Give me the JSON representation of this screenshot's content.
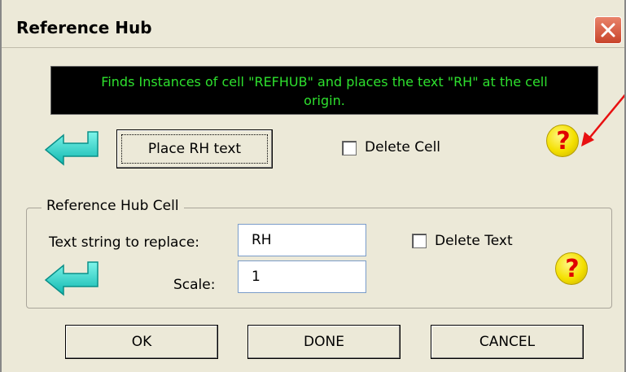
{
  "window": {
    "title": "Reference Hub",
    "close_icon": "close-icon"
  },
  "info": {
    "line1": "Finds  Instances of cell \"REFHUB\" and places the text \"RH\" at the cell",
    "line2": "origin."
  },
  "top_section": {
    "arrow_icon": "return-arrow-icon",
    "place_button_label": "Place RH text",
    "delete_cell_label": "Delete Cell",
    "delete_cell_checked": false,
    "help_icon": "help-icon"
  },
  "group": {
    "title": "Reference Hub Cell",
    "text_string_label": "Text string to replace:",
    "text_string_value": "RH",
    "delete_text_label": "Delete Text",
    "delete_text_checked": false,
    "scale_label": "Scale:",
    "scale_value": "1",
    "arrow_icon": "return-arrow-icon",
    "help_icon": "help-icon"
  },
  "footer": {
    "ok_label": "OK",
    "done_label": "DONE",
    "cancel_label": "CANCEL"
  },
  "colors": {
    "dialog_bg": "#ece9d8",
    "info_bg": "#000000",
    "info_text": "#2ee02e",
    "arrow_cyan": "#1ad6c8",
    "help_yellow": "#f4e000",
    "help_red": "#e00000",
    "annotation_red": "#e81010"
  }
}
